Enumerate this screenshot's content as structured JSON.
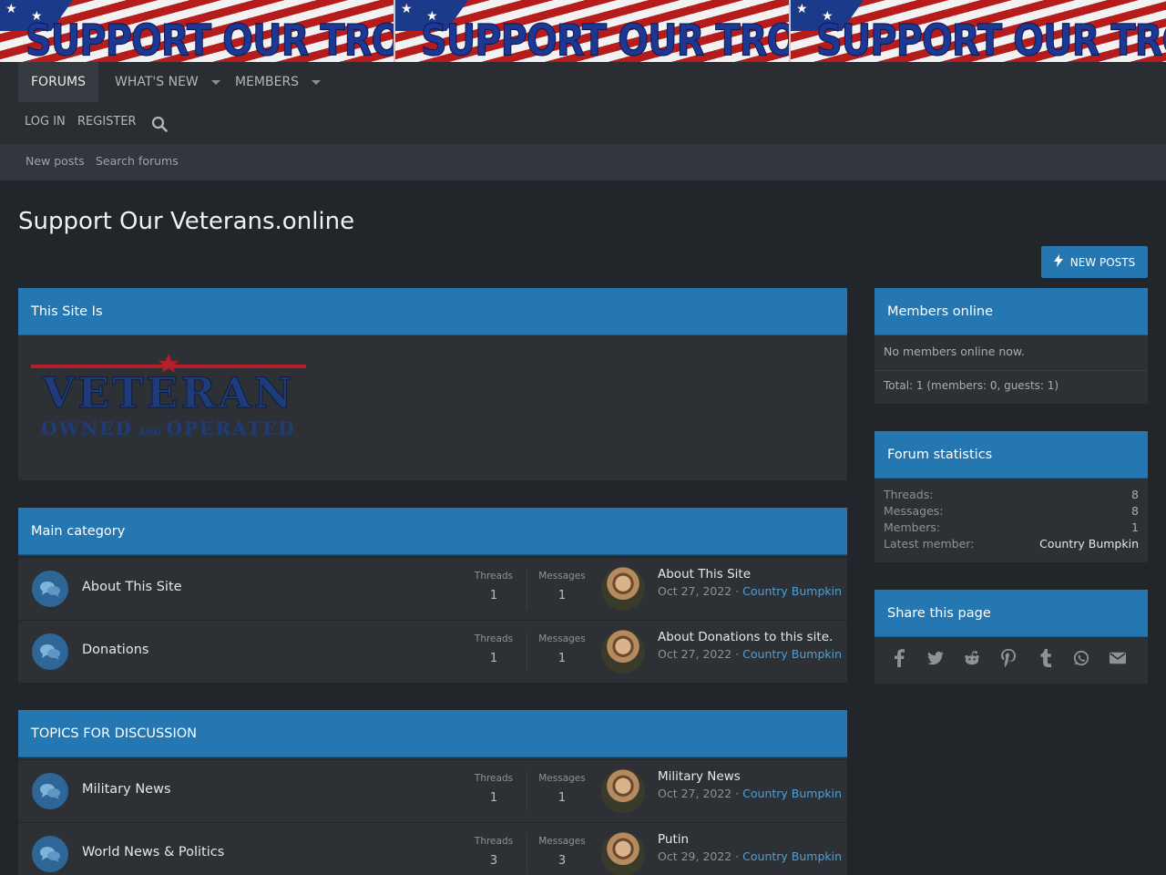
{
  "banner": {
    "text": "SUPPORT OUR TROOPS"
  },
  "nav": {
    "tabs": [
      {
        "label": "FORUMS"
      },
      {
        "label": "WHAT'S NEW"
      },
      {
        "label": "MEMBERS"
      }
    ],
    "login": "LOG IN",
    "register": "REGISTER",
    "search_icon": "search-icon"
  },
  "subnav": {
    "new_posts": "New posts",
    "search_forums": "Search forums"
  },
  "page": {
    "title": "Support Our Veterans.online",
    "new_posts_button": "NEW POSTS"
  },
  "this_site": {
    "header": "This Site Is",
    "logo": {
      "line1": "VETERAN",
      "line2_a": "OWNED",
      "line2_and": "AND",
      "line2_b": "OPERATED"
    }
  },
  "main_category": {
    "header": "Main category",
    "nodes": [
      {
        "title": "About This Site",
        "threads_label": "Threads",
        "threads": "1",
        "messages_label": "Messages",
        "messages": "1",
        "last_title": "About This Site",
        "last_date": "Oct 27, 2022",
        "last_user": "Country Bumpkin"
      },
      {
        "title": "Donations",
        "threads_label": "Threads",
        "threads": "1",
        "messages_label": "Messages",
        "messages": "1",
        "last_title": "About Donations to this site.",
        "last_date": "Oct 27, 2022",
        "last_user": "Country Bumpkin"
      }
    ]
  },
  "topics": {
    "header": "TOPICS FOR DISCUSSION",
    "nodes": [
      {
        "title": "Military News",
        "threads_label": "Threads",
        "threads": "1",
        "messages_label": "Messages",
        "messages": "1",
        "last_title": "Military News",
        "last_date": "Oct 27, 2022",
        "last_user": "Country Bumpkin"
      },
      {
        "title": "World News & Politics",
        "threads_label": "Threads",
        "threads": "3",
        "messages_label": "Messages",
        "messages": "3",
        "last_title": "Putin",
        "last_date": "Oct 29, 2022",
        "last_user": "Country Bumpkin"
      }
    ]
  },
  "members_online": {
    "header": "Members online",
    "none": "No members online now.",
    "total": "Total: 1 (members: 0, guests: 1)"
  },
  "forum_stats": {
    "header": "Forum statistics",
    "rows": [
      {
        "label": "Threads:",
        "value": "8"
      },
      {
        "label": "Messages:",
        "value": "8"
      },
      {
        "label": "Members:",
        "value": "1"
      },
      {
        "label": "Latest member:",
        "value": "Country Bumpkin"
      }
    ]
  },
  "share": {
    "header": "Share this page",
    "icons": [
      "facebook-icon",
      "twitter-icon",
      "reddit-icon",
      "pinterest-icon",
      "tumblr-icon",
      "whatsapp-icon",
      "email-icon"
    ]
  },
  "colors": {
    "accent": "#2577b1",
    "link": "#4aa0d8",
    "background": "#22252a"
  }
}
